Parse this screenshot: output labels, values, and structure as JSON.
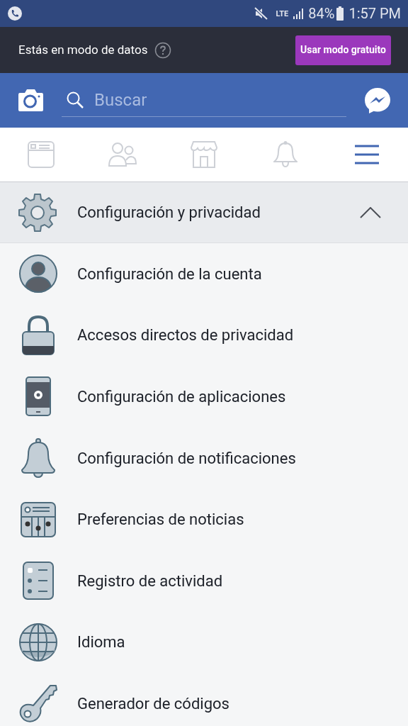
{
  "status_bar": {
    "battery": "84%",
    "time": "1:57 PM",
    "network": "LTE"
  },
  "data_banner": {
    "message": "Estás en modo de datos",
    "button": "Usar modo gratuito"
  },
  "search": {
    "placeholder": "Buscar"
  },
  "tabs": [
    {
      "kind": "feed",
      "selected": false
    },
    {
      "kind": "friends",
      "selected": false
    },
    {
      "kind": "marketplace",
      "selected": false
    },
    {
      "kind": "notifications",
      "selected": false
    },
    {
      "kind": "menu",
      "selected": true
    }
  ],
  "section": {
    "title": "Configuración y privacidad",
    "expanded": true,
    "items": [
      {
        "kind": "account",
        "label": "Configuración de la cuenta"
      },
      {
        "kind": "lock",
        "label": "Accesos directos de privacidad"
      },
      {
        "kind": "phone",
        "label": "Configuración de aplicaciones"
      },
      {
        "kind": "bell",
        "label": "Configuración de notificaciones"
      },
      {
        "kind": "news",
        "label": "Preferencias de noticias"
      },
      {
        "kind": "list",
        "label": "Registro de actividad"
      },
      {
        "kind": "globe",
        "label": "Idioma"
      },
      {
        "kind": "key",
        "label": "Generador de códigos"
      }
    ]
  }
}
